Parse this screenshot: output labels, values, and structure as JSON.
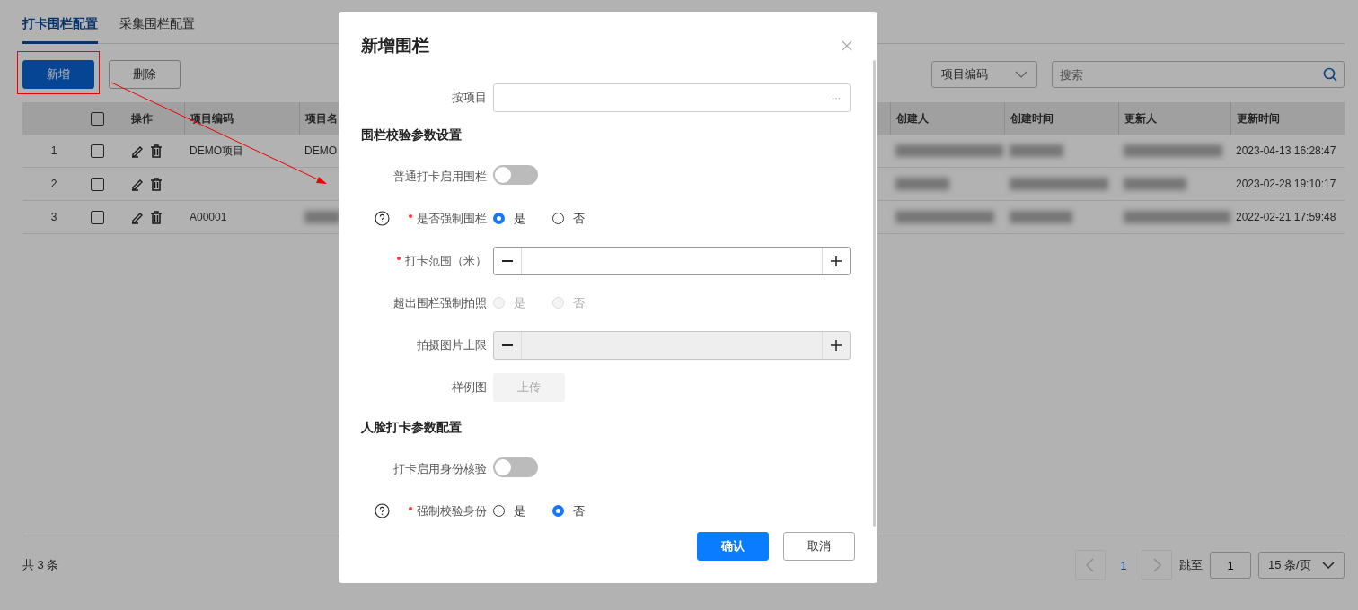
{
  "tabs": [
    {
      "label": "打卡围栏配置",
      "selected": true
    },
    {
      "label": "采集围栏配置",
      "selected": false
    }
  ],
  "toolbar": {
    "add_button": "新增",
    "delete_button": "删除",
    "filter_select": "项目编码",
    "search": {
      "placeholder": "搜索"
    }
  },
  "table": {
    "columns": [
      "操作",
      "项目编码",
      "项目名",
      "创建人",
      "创建时间",
      "更新人",
      "更新时间"
    ],
    "header_checked": false,
    "rows": [
      {
        "index": "1",
        "checked": false,
        "cells": [
          {
            "kind": "actions"
          },
          {
            "kind": "text",
            "text": "DEMO项目"
          },
          {
            "kind": "text",
            "text": "DEMO"
          },
          {
            "kind": "redacted"
          },
          {
            "kind": "redacted"
          },
          {
            "kind": "redacted"
          },
          {
            "kind": "text",
            "text": "2023-04-13 16:28:47"
          }
        ]
      },
      {
        "index": "2",
        "checked": false,
        "cells": [
          {
            "kind": "actions"
          },
          {
            "kind": "empty"
          },
          {
            "kind": "empty"
          },
          {
            "kind": "redacted"
          },
          {
            "kind": "redacted"
          },
          {
            "kind": "redacted"
          },
          {
            "kind": "text",
            "text": "2023-02-28 19:10:17"
          }
        ]
      },
      {
        "index": "3",
        "checked": false,
        "cells": [
          {
            "kind": "actions"
          },
          {
            "kind": "text",
            "text": "A00001"
          },
          {
            "kind": "redacted"
          },
          {
            "kind": "redacted"
          },
          {
            "kind": "redacted"
          },
          {
            "kind": "redacted"
          },
          {
            "kind": "text",
            "text": "2022-02-21 17:59:48"
          }
        ]
      }
    ]
  },
  "footer": {
    "total": "共 3 条",
    "pages": [
      {
        "label": "1",
        "selected": true
      }
    ],
    "jump_label": "跳至",
    "jump_value": "1",
    "page_size": "15 条/页"
  },
  "modal": {
    "title": "新增围栏",
    "fields": [
      {
        "kind": "picker",
        "label": "按项目",
        "dots": "···"
      },
      {
        "kind": "section",
        "label": "围栏校验参数设置"
      },
      {
        "kind": "switch",
        "label": "普通打卡启用围栏",
        "on": false
      },
      {
        "kind": "radio",
        "label": "是否强制围栏",
        "required": true,
        "help": true,
        "disabled": false,
        "options": [
          {
            "label": "是",
            "selected": true
          },
          {
            "label": "否",
            "selected": false
          }
        ]
      },
      {
        "kind": "stepper",
        "label": "打卡范围（米）",
        "required": true,
        "disabled": false
      },
      {
        "kind": "radio",
        "label": "超出围栏强制拍照",
        "required": false,
        "help": false,
        "disabled": true,
        "options": [
          {
            "label": "是",
            "selected": false
          },
          {
            "label": "否",
            "selected": false
          }
        ]
      },
      {
        "kind": "stepper",
        "label": "拍摄图片上限",
        "required": false,
        "disabled": true
      },
      {
        "kind": "upload",
        "label": "样例图",
        "button": "上传",
        "disabled": true
      },
      {
        "kind": "section",
        "label": "人脸打卡参数配置"
      },
      {
        "kind": "switch",
        "label": "打卡启用身份核验",
        "on": false
      },
      {
        "kind": "radio",
        "label": "强制校验身份",
        "required": true,
        "help": true,
        "disabled": false,
        "options": [
          {
            "label": "是",
            "selected": false
          },
          {
            "label": "否",
            "selected": true
          }
        ]
      }
    ],
    "confirm": "确认",
    "cancel": "取消"
  }
}
